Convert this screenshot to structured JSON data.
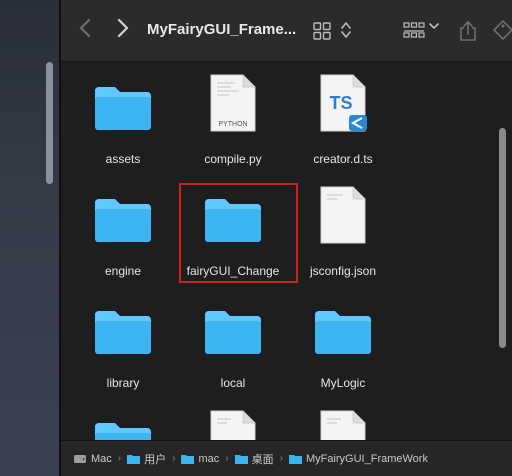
{
  "window": {
    "title": "MyFairyGUI_Frame...",
    "nav": {
      "back_icon": "chevron-left-icon",
      "forward_icon": "chevron-right-icon"
    },
    "toolbar_icons": [
      "icon-view-grid-icon",
      "view-toggle-arrows-icon",
      "group-by-icon",
      "share-icon",
      "tag-icon"
    ]
  },
  "items": [
    {
      "name": "assets",
      "kind": "folder"
    },
    {
      "name": "compile.py",
      "kind": "python-file",
      "badge": "PYTHON"
    },
    {
      "name": "creator.d.ts",
      "kind": "typescript-file",
      "badge": "TS"
    },
    {
      "name": "engine",
      "kind": "folder"
    },
    {
      "name": "fairyGUI_Change",
      "kind": "folder",
      "selected": true
    },
    {
      "name": "jsconfig.json",
      "kind": "generic-file"
    },
    {
      "name": "library",
      "kind": "folder"
    },
    {
      "name": "local",
      "kind": "folder"
    },
    {
      "name": "MyLogic",
      "kind": "folder"
    },
    {
      "name": "",
      "kind": "folder"
    },
    {
      "name": "",
      "kind": "generic-file"
    },
    {
      "name": "",
      "kind": "generic-file"
    }
  ],
  "pathbar": {
    "crumbs": [
      "Mac",
      "用户",
      "mac",
      "桌面",
      "MyFairyGUI_FrameWork"
    ]
  },
  "colors": {
    "folder_top": "#5ec8ff",
    "folder_body": "#3db4f2",
    "selection_outline": "#d0211b",
    "ts_blue": "#2f7fd1"
  }
}
